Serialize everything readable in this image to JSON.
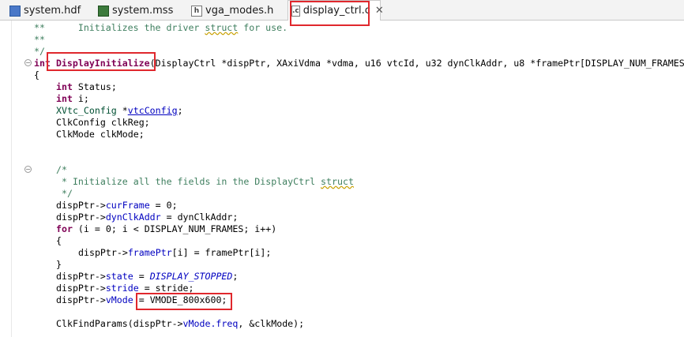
{
  "tabs": [
    {
      "label": "system.hdf",
      "icon": "hdf-file-icon"
    },
    {
      "label": "system.mss",
      "icon": "mss-file-icon"
    },
    {
      "label": "vga_modes.h",
      "icon": "header-file-icon"
    },
    {
      "label": "display_ctrl.c",
      "icon": "c-file-icon",
      "active": true,
      "close": "✕"
    }
  ],
  "code": {
    "l1a": "**      Initializes the driver ",
    "l1b": "struct",
    "l1c": " for use.",
    "l2": "**",
    "l3": "*/",
    "l4_kw": "int",
    "l4_fn": "DisplayInitialize",
    "l4_rest": "(DisplayCtrl *dispPtr, XAxiVdma *vdma, u16 vtcId, u32 dynClkAddr, u8 *framePtr[DISPLAY_NUM_FRAMES",
    "l5": "{",
    "l6_kw": "int",
    "l6_rest": " Status;",
    "l7_kw": "int",
    "l7_rest": " i;",
    "l8_type": "XVtc_Config",
    "l8_star": " *",
    "l8_var": "vtcConfig",
    "l8_end": ";",
    "l9": "ClkConfig clkReg;",
    "l10": "ClkMode clkMode;",
    "c1": "/*",
    "c2a": " * Initialize all the fields in the DisplayCtrl ",
    "c2b": "struct",
    "c3": " */",
    "s1a": "dispPtr->",
    "s1b": "curFrame",
    "s1c": " = 0;",
    "s2a": "dispPtr->",
    "s2b": "dynClkAddr",
    "s2c": " = dynClkAddr;",
    "s3_kw": "for",
    "s3_rest": " (i = 0; i < DISPLAY_NUM_FRAMES; i++)",
    "s4": "{",
    "s5a": "dispPtr->",
    "s5b": "framePtr",
    "s5c": "[i] = framePtr[i];",
    "s6": "}",
    "s7a": "dispPtr->",
    "s7b": "state",
    "s7c": " = ",
    "s7d": "DISPLAY_STOPPED",
    "s7e": ";",
    "s8a": "dispPtr->",
    "s8b": "stride",
    "s8c": " = stride;",
    "s9a": "dispPtr->",
    "s9b": "vMode",
    "s9c": " = ",
    "s9d": "VMODE_800x600;",
    "s10a": "ClkFindParams(dispPtr->",
    "s10b": "vMode.freq",
    "s10c": ", &clkMode);"
  },
  "colors": {
    "highlight_box": "#e0282d",
    "keyword": "#7f0055",
    "comment": "#3f7f5f",
    "field": "#0000c0"
  }
}
